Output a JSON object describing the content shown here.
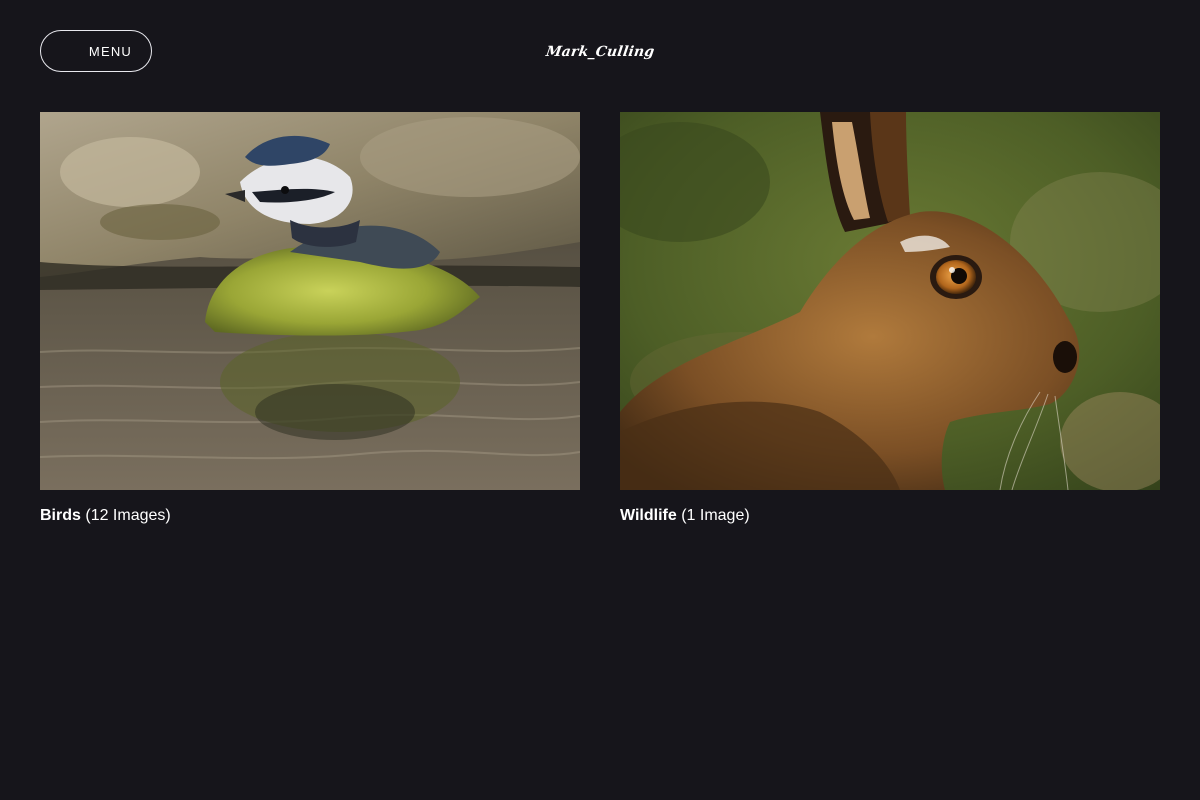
{
  "header": {
    "menu_label": "MENU",
    "logo_text": "Mark_Culling"
  },
  "gallery": {
    "items": [
      {
        "title": "Birds",
        "count": "(12 Images)",
        "thumbnail": "blue-tit-bathing-photo"
      },
      {
        "title": "Wildlife",
        "count": "(1 Image)",
        "thumbnail": "brown-hare-portrait-photo"
      }
    ]
  },
  "colors": {
    "background": "#16151b",
    "text": "#ffffff",
    "menu_border": "#e8e8ee"
  }
}
